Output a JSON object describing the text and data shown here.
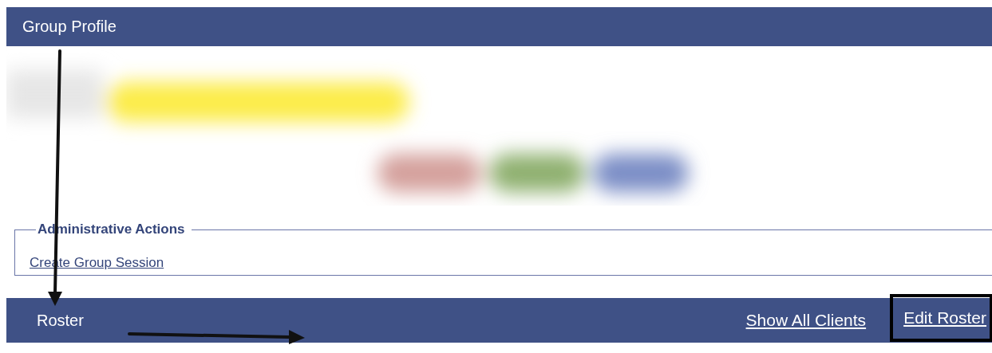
{
  "header": {
    "title": "Group Profile"
  },
  "admin_actions": {
    "legend": "Administrative Actions",
    "links": [
      {
        "label": "Create Group Session"
      }
    ]
  },
  "roster_bar": {
    "title": "Roster",
    "links": [
      {
        "label": "Show All Clients",
        "highlighted": false
      },
      {
        "label": "Edit Roster",
        "highlighted": true
      }
    ]
  }
}
